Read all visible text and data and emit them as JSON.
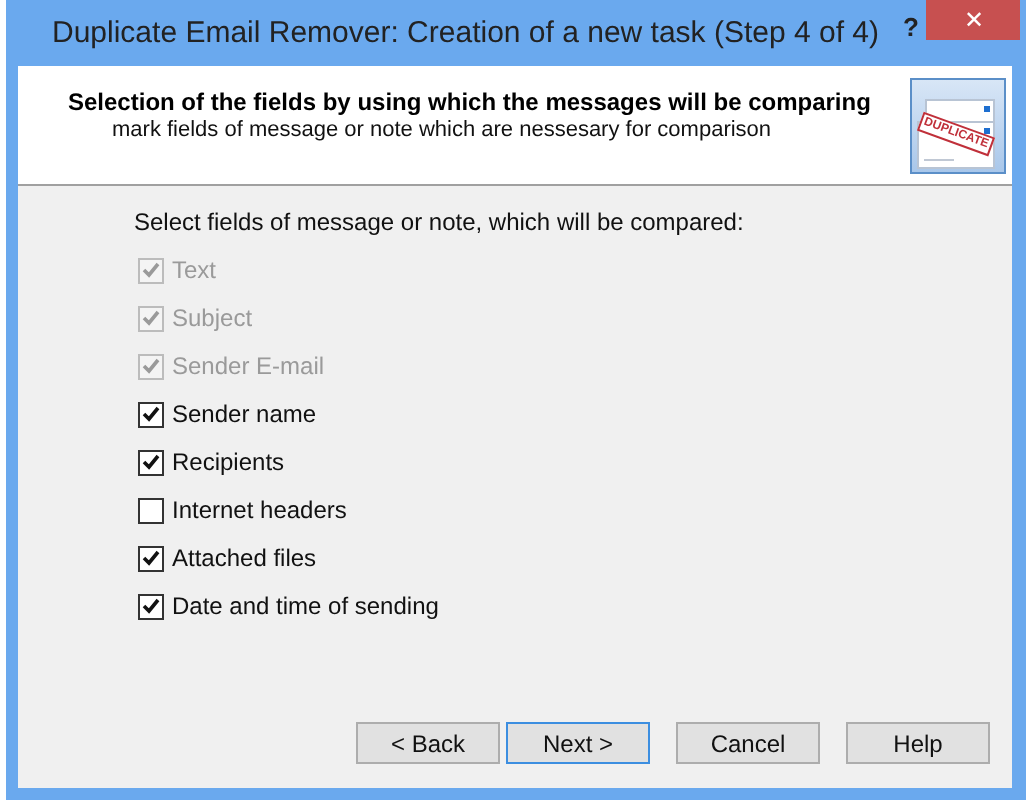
{
  "window": {
    "title": "Duplicate Email Remover: Creation of a new task (Step 4 of 4)",
    "help_glyph": "?",
    "close_glyph": "✕"
  },
  "header": {
    "title": "Selection of the fields by using which the messages will be comparing",
    "subtitle": "mark fields of message or note which are nessesary for comparison",
    "stamp": "DUPLICATE"
  },
  "prompt": "Select fields of message or note, which will be compared:",
  "fields": [
    {
      "label": "Text",
      "checked": true,
      "disabled": true
    },
    {
      "label": "Subject",
      "checked": true,
      "disabled": true
    },
    {
      "label": "Sender E-mail",
      "checked": true,
      "disabled": true
    },
    {
      "label": "Sender name",
      "checked": true,
      "disabled": false
    },
    {
      "label": "Recipients",
      "checked": true,
      "disabled": false
    },
    {
      "label": "Internet headers",
      "checked": false,
      "disabled": false
    },
    {
      "label": "Attached files",
      "checked": true,
      "disabled": false
    },
    {
      "label": "Date and time of sending",
      "checked": true,
      "disabled": false
    }
  ],
  "buttons": [
    {
      "label": "< Back",
      "selected": false
    },
    {
      "label": "Next >",
      "selected": true
    },
    {
      "label": "Cancel",
      "selected": false
    },
    {
      "label": "Help",
      "selected": false
    }
  ]
}
